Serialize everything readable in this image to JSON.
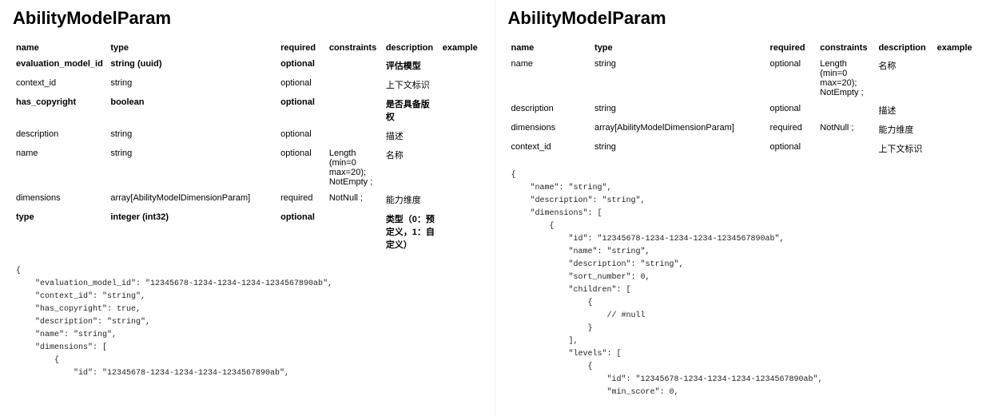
{
  "left": {
    "title": "AbilityModelParam",
    "headers": {
      "name": "name",
      "type": "type",
      "required": "required",
      "constraints": "constraints",
      "description": "description",
      "example": "example"
    },
    "rows": [
      {
        "bold": true,
        "name": "evaluation_model_id",
        "type": "string (uuid)",
        "required": "optional",
        "constraints": "",
        "description": "评估模型",
        "example": ""
      },
      {
        "bold": false,
        "name": "context_id",
        "type": "string",
        "required": "optional",
        "constraints": "",
        "description": "上下文标识",
        "example": ""
      },
      {
        "bold": true,
        "name": "has_copyright",
        "type": "boolean",
        "required": "optional",
        "constraints": "",
        "description": "是否具备版权",
        "example": ""
      },
      {
        "bold": false,
        "name": "description",
        "type": "string",
        "required": "optional",
        "constraints": "",
        "description": "描述",
        "example": ""
      },
      {
        "bold": false,
        "name": "name",
        "type": "string",
        "required": "optional",
        "constraints": "Length (min=0 max=20); NotEmpty ;",
        "description": "名称",
        "example": ""
      },
      {
        "bold": false,
        "name": "dimensions",
        "type": "array[AbilityModelDimensionParam]",
        "required": "required",
        "constraints": "NotNull ;",
        "description": "能力维度",
        "example": ""
      },
      {
        "bold": true,
        "name": "type",
        "type": "integer (int32)",
        "required": "optional",
        "constraints": "",
        "description": "类型（0：预定义，1：自定义）",
        "example": ""
      }
    ],
    "code": "{\n    \"evaluation_model_id\": \"12345678-1234-1234-1234-1234567890ab\",\n    \"context_id\": \"string\",\n    \"has_copyright\": true,\n    \"description\": \"string\",\n    \"name\": \"string\",\n    \"dimensions\": [\n        {\n            \"id\": \"12345678-1234-1234-1234-1234567890ab\","
  },
  "right": {
    "title": "AbilityModelParam",
    "headers": {
      "name": "name",
      "type": "type",
      "required": "required",
      "constraints": "constraints",
      "description": "description",
      "example": "example"
    },
    "rows": [
      {
        "bold": false,
        "name": "name",
        "type": "string",
        "required": "optional",
        "constraints": "Length (min=0 max=20); NotEmpty ;",
        "description": "名称",
        "example": ""
      },
      {
        "bold": false,
        "name": "description",
        "type": "string",
        "required": "optional",
        "constraints": "",
        "description": "描述",
        "example": ""
      },
      {
        "bold": false,
        "name": "dimensions",
        "type": "array[AbilityModelDimensionParam]",
        "required": "required",
        "constraints": "NotNull ;",
        "description": "能力维度",
        "example": ""
      },
      {
        "bold": false,
        "name": "context_id",
        "type": "string",
        "required": "optional",
        "constraints": "",
        "description": "上下文标识",
        "example": ""
      }
    ],
    "code": "{\n    \"name\": \"string\",\n    \"description\": \"string\",\n    \"dimensions\": [\n        {\n            \"id\": \"12345678-1234-1234-1234-1234567890ab\",\n            \"name\": \"string\",\n            \"description\": \"string\",\n            \"sort_number\": 0,\n            \"children\": [\n                {\n                    // #null\n                }\n            ],\n            \"levels\": [\n                {\n                    \"id\": \"12345678-1234-1234-1234-1234567890ab\",\n                    \"min_score\": 0,"
  }
}
